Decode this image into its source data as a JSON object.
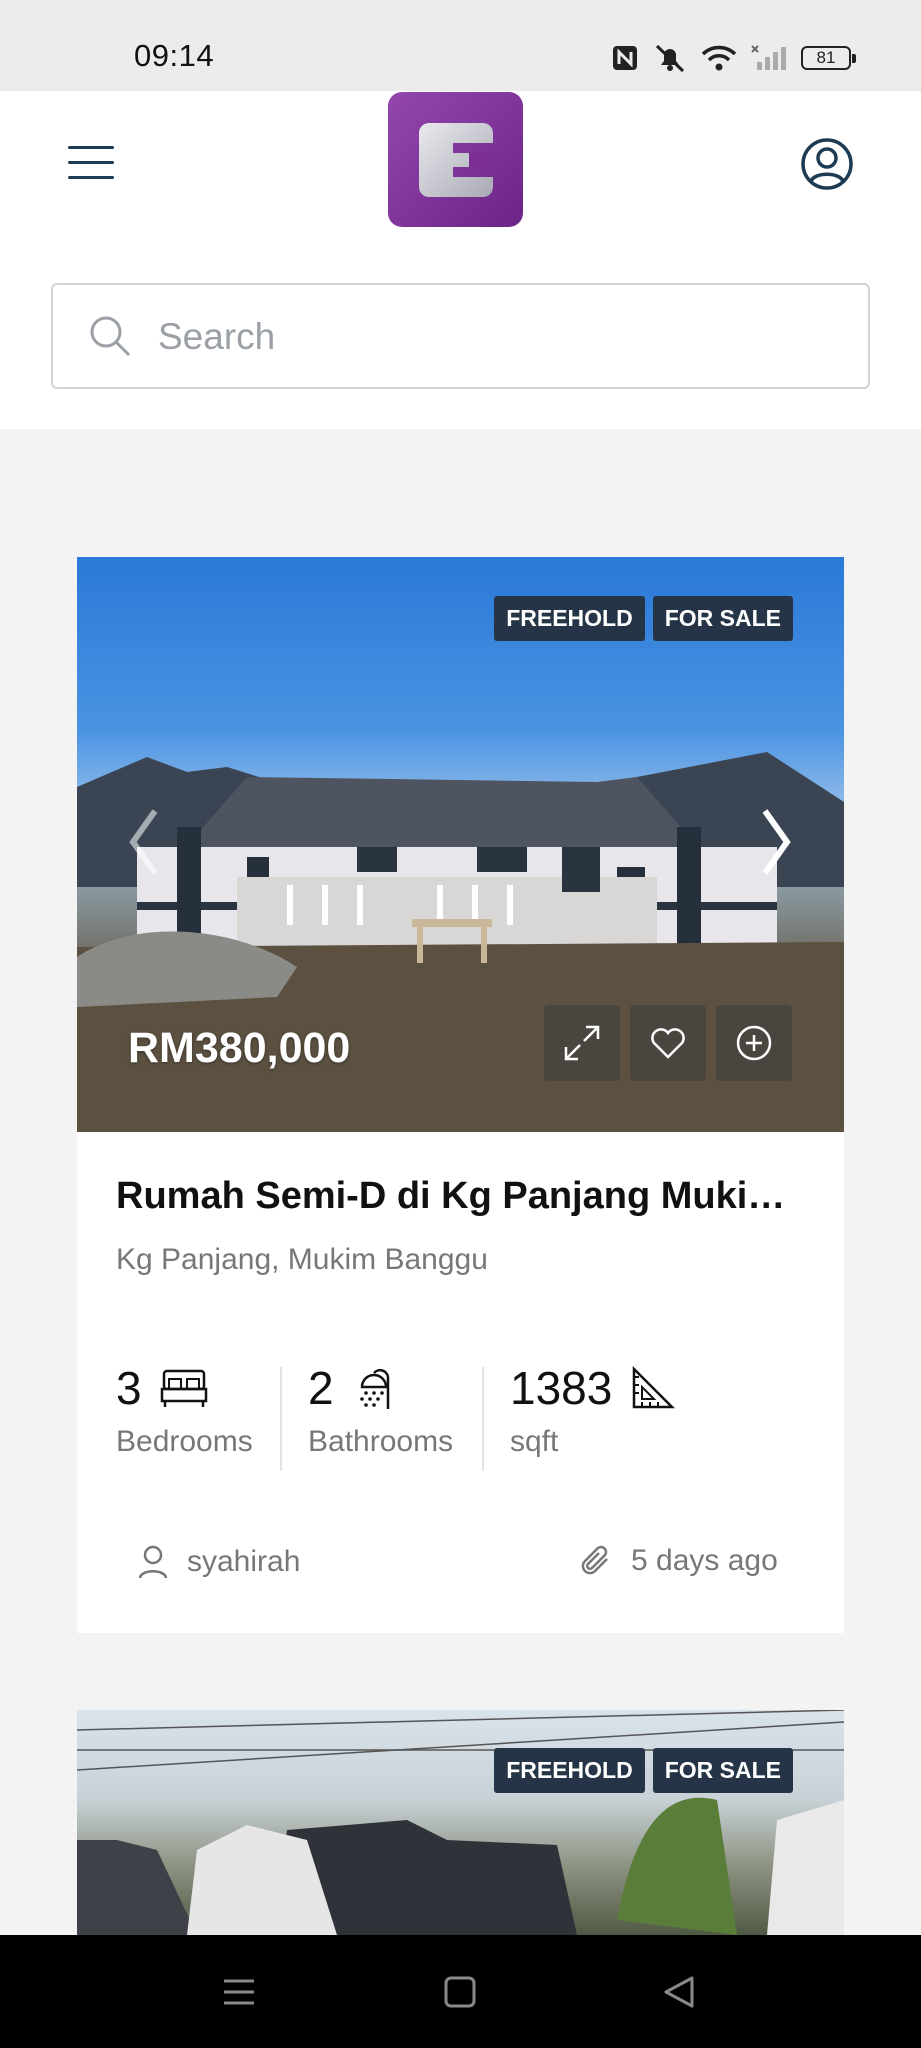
{
  "status_bar": {
    "time": "09:14",
    "battery": "81"
  },
  "header": {
    "menu_icon": "hamburger-menu-icon",
    "logo_icon": "app-logo-e",
    "account_icon": "user-circle-icon"
  },
  "search": {
    "placeholder": "Search",
    "value": ""
  },
  "listings": [
    {
      "badges": [
        "FREEHOLD",
        "FOR SALE"
      ],
      "price": "RM380,000",
      "title": "Rumah Semi-D di Kg Panjang Muki…",
      "location": "Kg Panjang, Mukim Banggu",
      "bedrooms": {
        "value": "3",
        "label": "Bedrooms"
      },
      "bathrooms": {
        "value": "2",
        "label": "Bathrooms"
      },
      "area": {
        "value": "1383",
        "label": "sqft"
      },
      "agent": "syahirah",
      "posted": "5 days ago"
    },
    {
      "badges": [
        "FREEHOLD",
        "FOR SALE"
      ]
    }
  ]
}
